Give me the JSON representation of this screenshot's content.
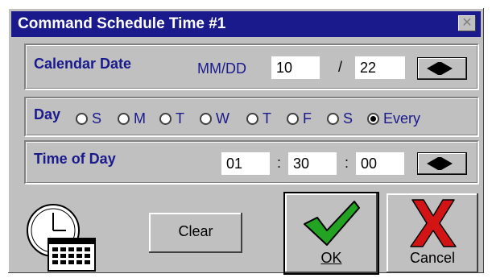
{
  "window": {
    "title": "Command Schedule Time #1",
    "close_glyph": "✕"
  },
  "calendar": {
    "label": "Calendar Date",
    "format": "MM/DD",
    "month": "10",
    "separator": "/",
    "day": "22"
  },
  "day": {
    "label": "Day",
    "options": [
      "S",
      "M",
      "T",
      "W",
      "T",
      "F",
      "S",
      "Every"
    ],
    "selected": "Every"
  },
  "time": {
    "label": "Time of Day",
    "hour": "01",
    "minute": "30",
    "second": "00",
    "separator": ":"
  },
  "buttons": {
    "clear": "Clear",
    "ok": "OK",
    "cancel": "Cancel"
  },
  "colors": {
    "title_bar": "#1a1a8c",
    "label": "#1a1a8c",
    "ok_check": "#22a322",
    "cancel_x": "#d21414"
  }
}
